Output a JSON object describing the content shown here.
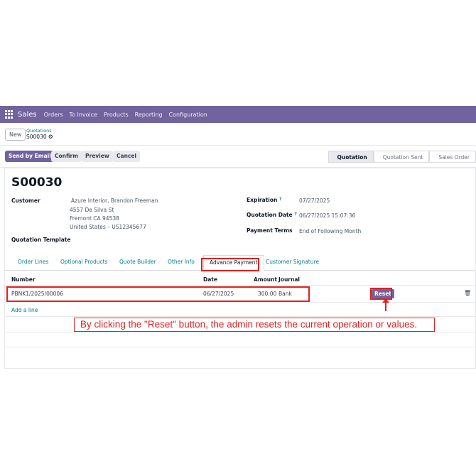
{
  "navbar": {
    "app_name": "Sales",
    "items": [
      "Orders",
      "To Invoice",
      "Products",
      "Reporting",
      "Configuration"
    ]
  },
  "breadcrumb": {
    "new_label": "New",
    "parent": "Quotations",
    "current": "S00030"
  },
  "actions": {
    "send_by_email": "Send by Email",
    "confirm": "Confirm",
    "preview": "Preview",
    "cancel": "Cancel"
  },
  "statusbar": {
    "stages": [
      "Quotation",
      "Quotation Sent",
      "Sales Order"
    ],
    "active": "Quotation"
  },
  "form": {
    "title": "S00030",
    "customer_label": "Customer",
    "customer_name": "Azure Interior, Brandon Freeman",
    "address_line1": "4557 De Silva St",
    "address_line2": "Fremont CA 94538",
    "address_line3": "United States – US12345677",
    "quotation_template_label": "Quotation Template",
    "expiration_label": "Expiration",
    "expiration_value": "07/27/2025",
    "quotation_date_label": "Quotation Date",
    "quotation_date_value": "06/27/2025 15:07:36",
    "payment_terms_label": "Payment Terms",
    "payment_terms_value": "End of Following Month",
    "help_mark": "?"
  },
  "tabs": {
    "order_lines": "Order Lines",
    "optional_products": "Optional Products",
    "quote_builder": "Quote Builder",
    "other_info": "Other Info",
    "advance_payment": "Advance Payment",
    "customer_signature": "Customer Signature"
  },
  "table": {
    "headers": {
      "number": "Number",
      "date": "Date",
      "amount": "Amount",
      "journal": "Journal"
    },
    "rows": [
      {
        "number": "PBNK1/2025/00006",
        "date": "06/27/2025",
        "amount": "300.00",
        "journal": "Bank",
        "reset": "Reset"
      }
    ],
    "add_line": "Add a line"
  },
  "annotation": {
    "text": "By clicking the \"Reset\" button, the admin resets the current operation or values.",
    "color": "#e02020"
  },
  "colors": {
    "brand": "#71639e",
    "link": "#017e84"
  }
}
